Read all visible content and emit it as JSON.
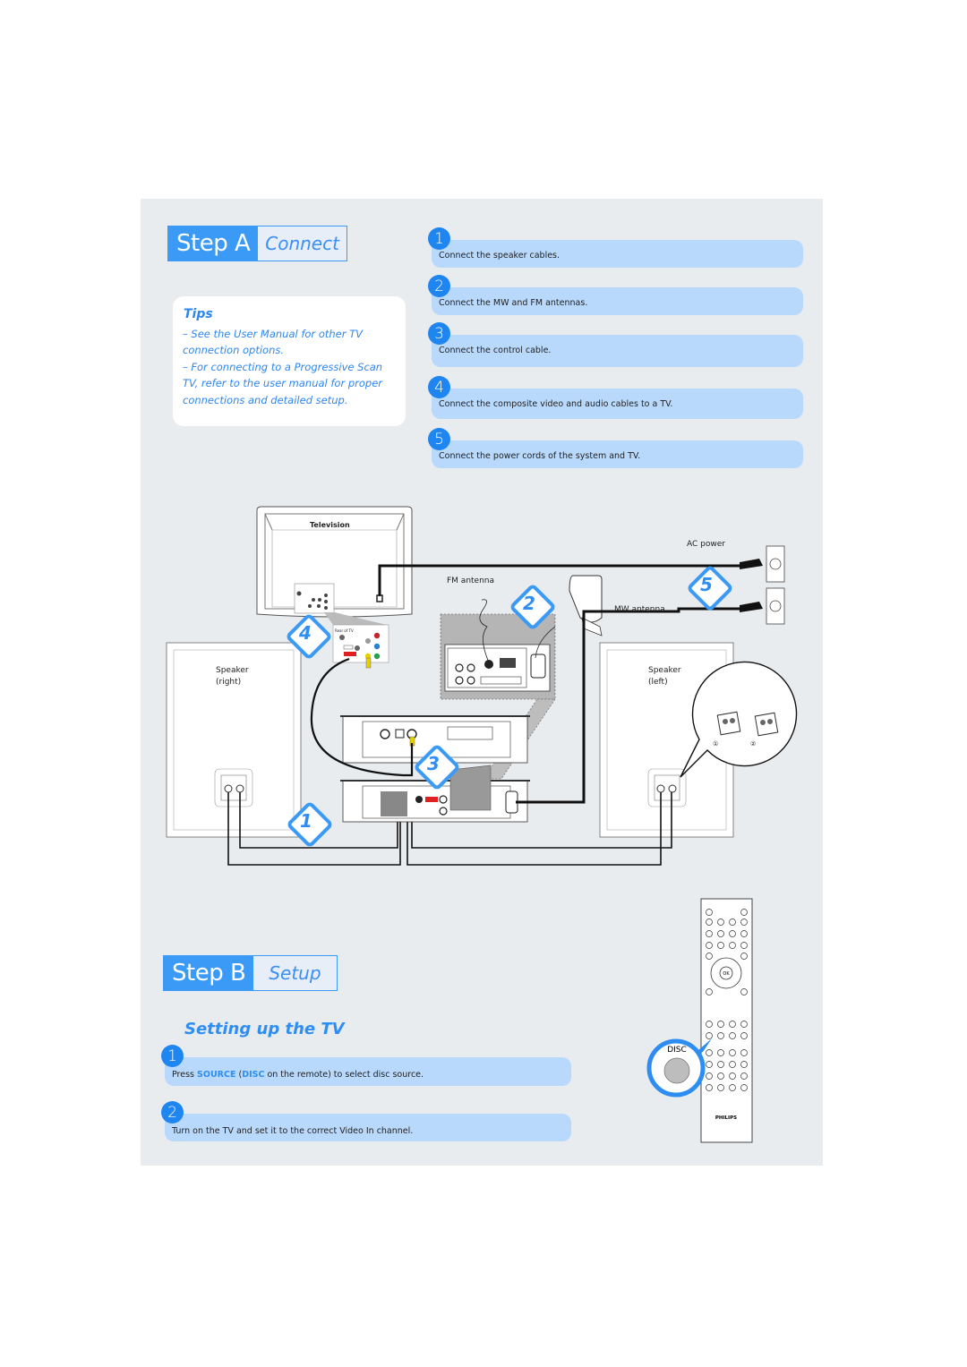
{
  "step_a": {
    "label": "Step A",
    "sub": "Connect",
    "tips": {
      "title": "Tips",
      "lines": [
        "–  See the User Manual for other TV",
        "connection options.",
        "–  For connecting to a Progressive Scan",
        "TV, refer to the user manual for proper",
        "connections and detailed setup."
      ]
    },
    "steps": [
      {
        "num": "1",
        "text": "Connect the speaker cables."
      },
      {
        "num": "2",
        "text": "Connect the MW and FM antennas."
      },
      {
        "num": "3",
        "text": "Connect the control cable."
      },
      {
        "num": "4",
        "text": "Connect the composite video and audio cables to a TV."
      },
      {
        "num": "5",
        "text": "Connect the power cords of the system and TV."
      }
    ]
  },
  "diagram": {
    "television_label": "Television",
    "rear_of_tv_label": "Rear of TV",
    "fm_antenna": "FM antenna",
    "mw_antenna": "MW antenna",
    "ac_power": "AC power",
    "speaker_right": [
      "Speaker",
      "(right)"
    ],
    "speaker_left": [
      "Speaker",
      "(left)"
    ],
    "callouts": [
      "1",
      "2",
      "3",
      "4",
      "5"
    ],
    "detail_marks": [
      "①",
      "②"
    ]
  },
  "step_b": {
    "label": "Step B",
    "sub": "Setup",
    "section_title": "Setting up the TV",
    "steps": [
      {
        "num": "1",
        "pre": "Press ",
        "kw1": "SOURCE",
        "mid": " (",
        "kw2": "DISC",
        "post": " on the remote) to select disc source."
      },
      {
        "num": "2",
        "text": "Turn on the TV and set it to the correct Video In channel."
      }
    ]
  },
  "remote": {
    "disc_label": "DISC",
    "brand": "PHILIPS",
    "ok_label": "OK"
  },
  "colors": {
    "accent": "#3a9af6",
    "bar": "#b9d9fc",
    "panel": "#e9ecef"
  }
}
